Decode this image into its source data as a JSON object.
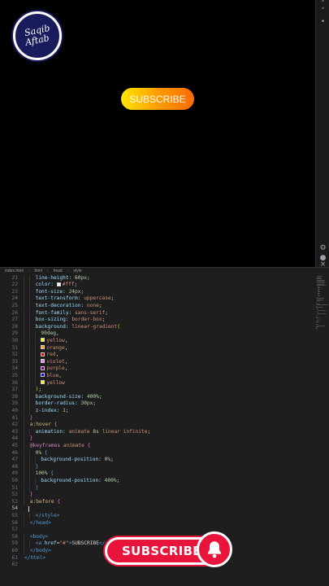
{
  "preview": {
    "logo_line1": "Saqib",
    "logo_line2": "Aftab",
    "button_label": "SUBSCRIBE"
  },
  "preview_bar": {
    "icons": [
      "chevron-up-icon",
      "chevron-down-icon",
      "dot-icon",
      "gear-icon",
      "account-icon",
      "close-icon"
    ]
  },
  "breadcrumb": [
    "index.html",
    "html",
    "head",
    "style"
  ],
  "code_lines": [
    {
      "n": "21",
      "indent": 2,
      "parts": [
        [
          "p",
          "line-height"
        ],
        [
          "w",
          ": "
        ],
        [
          "n",
          "60px"
        ],
        [
          "w",
          ";"
        ]
      ]
    },
    {
      "n": "22",
      "indent": 2,
      "parts": [
        [
          "p",
          "color"
        ],
        [
          "w",
          ": "
        ],
        [
          "sw",
          "#ffffff"
        ],
        [
          "v",
          "#fff"
        ],
        [
          "w",
          ";"
        ]
      ]
    },
    {
      "n": "23",
      "indent": 2,
      "parts": [
        [
          "p",
          "font-size"
        ],
        [
          "w",
          ": "
        ],
        [
          "n",
          "24px"
        ],
        [
          "w",
          ";"
        ]
      ]
    },
    {
      "n": "24",
      "indent": 2,
      "parts": [
        [
          "p",
          "text-transform"
        ],
        [
          "w",
          ": "
        ],
        [
          "v",
          "uppercase"
        ],
        [
          "w",
          ";"
        ]
      ]
    },
    {
      "n": "25",
      "indent": 2,
      "parts": [
        [
          "p",
          "text-decoration"
        ],
        [
          "w",
          ": "
        ],
        [
          "v",
          "none"
        ],
        [
          "w",
          ";"
        ]
      ]
    },
    {
      "n": "26",
      "indent": 2,
      "parts": [
        [
          "p",
          "font-family"
        ],
        [
          "w",
          ": "
        ],
        [
          "v",
          "sans-serif"
        ],
        [
          "w",
          ";"
        ]
      ]
    },
    {
      "n": "27",
      "indent": 2,
      "parts": [
        [
          "p",
          "box-sizing"
        ],
        [
          "w",
          ": "
        ],
        [
          "v",
          "border-box"
        ],
        [
          "w",
          ";"
        ]
      ]
    },
    {
      "n": "28",
      "indent": 2,
      "parts": [
        [
          "p",
          "background"
        ],
        [
          "w",
          ": "
        ],
        [
          "v",
          "linear-gradient"
        ],
        [
          "b1",
          "("
        ]
      ]
    },
    {
      "n": "29",
      "indent": 3,
      "parts": [
        [
          "n",
          "90deg"
        ],
        [
          "w",
          ","
        ]
      ]
    },
    {
      "n": "30",
      "indent": 3,
      "parts": [
        [
          "sw",
          "#ffff00"
        ],
        [
          "v",
          "yellow"
        ],
        [
          "w",
          ","
        ]
      ]
    },
    {
      "n": "31",
      "indent": 3,
      "parts": [
        [
          "sw",
          "#ffa500"
        ],
        [
          "v",
          "orange"
        ],
        [
          "w",
          ","
        ]
      ]
    },
    {
      "n": "32",
      "indent": 3,
      "parts": [
        [
          "sw",
          "#ff0000"
        ],
        [
          "v",
          "red"
        ],
        [
          "w",
          ","
        ]
      ]
    },
    {
      "n": "33",
      "indent": 3,
      "parts": [
        [
          "sw",
          "#ee82ee"
        ],
        [
          "v",
          "violet"
        ],
        [
          "w",
          ","
        ]
      ]
    },
    {
      "n": "34",
      "indent": 3,
      "parts": [
        [
          "sw",
          "#800080"
        ],
        [
          "v",
          "purple"
        ],
        [
          "w",
          ","
        ]
      ]
    },
    {
      "n": "35",
      "indent": 3,
      "parts": [
        [
          "sw",
          "#0000ff"
        ],
        [
          "v",
          "blue"
        ],
        [
          "w",
          ","
        ]
      ]
    },
    {
      "n": "36",
      "indent": 3,
      "parts": [
        [
          "sw",
          "#ffff00"
        ],
        [
          "v",
          "yellow"
        ]
      ]
    },
    {
      "n": "37",
      "indent": 2,
      "parts": [
        [
          "b1",
          ")"
        ],
        [
          "w",
          ";"
        ]
      ]
    },
    {
      "n": "38",
      "indent": 2,
      "parts": [
        [
          "p",
          "background-size"
        ],
        [
          "w",
          ": "
        ],
        [
          "n",
          "400%"
        ],
        [
          "w",
          ";"
        ]
      ]
    },
    {
      "n": "39",
      "indent": 2,
      "parts": [
        [
          "p",
          "border-radius"
        ],
        [
          "w",
          ": "
        ],
        [
          "n",
          "30px"
        ],
        [
          "w",
          ";"
        ]
      ]
    },
    {
      "n": "40",
      "indent": 2,
      "parts": [
        [
          "p",
          "z-index"
        ],
        [
          "w",
          ": "
        ],
        [
          "n",
          "1"
        ],
        [
          "w",
          ";"
        ]
      ]
    },
    {
      "n": "41",
      "indent": 1,
      "parts": [
        [
          "b2",
          "}"
        ]
      ]
    },
    {
      "n": "42",
      "indent": 1,
      "parts": [
        [
          "s",
          "a:hover"
        ],
        [
          "w",
          " "
        ],
        [
          "b2",
          "{"
        ]
      ]
    },
    {
      "n": "43",
      "indent": 2,
      "parts": [
        [
          "p",
          "animation"
        ],
        [
          "w",
          ": "
        ],
        [
          "v",
          "animate "
        ],
        [
          "n",
          "8s"
        ],
        [
          "v",
          " linear infinite"
        ],
        [
          "w",
          ";"
        ]
      ]
    },
    {
      "n": "44",
      "indent": 1,
      "parts": [
        [
          "b2",
          "}"
        ]
      ]
    },
    {
      "n": "45",
      "indent": 1,
      "parts": [
        [
          "k",
          "@keyframes"
        ],
        [
          "w",
          " "
        ],
        [
          "v",
          "animate"
        ],
        [
          "w",
          " "
        ],
        [
          "b2",
          "{"
        ]
      ]
    },
    {
      "n": "46",
      "indent": 2,
      "parts": [
        [
          "n",
          "0%"
        ],
        [
          "w",
          " "
        ],
        [
          "t",
          "{"
        ]
      ]
    },
    {
      "n": "47",
      "indent": 3,
      "parts": [
        [
          "p",
          "background-position"
        ],
        [
          "w",
          ": "
        ],
        [
          "n",
          "0%"
        ],
        [
          "w",
          ";"
        ]
      ]
    },
    {
      "n": "48",
      "indent": 2,
      "parts": [
        [
          "t",
          "}"
        ]
      ]
    },
    {
      "n": "49",
      "indent": 2,
      "parts": [
        [
          "n",
          "100%"
        ],
        [
          "w",
          " "
        ],
        [
          "t",
          "{"
        ]
      ]
    },
    {
      "n": "50",
      "indent": 3,
      "parts": [
        [
          "p",
          "background-position"
        ],
        [
          "w",
          ": "
        ],
        [
          "n",
          "400%"
        ],
        [
          "w",
          ";"
        ]
      ]
    },
    {
      "n": "51",
      "indent": 2,
      "parts": [
        [
          "t",
          "}"
        ]
      ]
    },
    {
      "n": "52",
      "indent": 1,
      "parts": [
        [
          "b2",
          "}"
        ]
      ]
    },
    {
      "n": "53",
      "indent": 1,
      "parts": [
        [
          "s",
          "a:before"
        ],
        [
          "w",
          " "
        ],
        [
          "b2",
          "{"
        ]
      ]
    },
    {
      "n": "54",
      "indent": 0,
      "parts": [],
      "cursor": true
    },
    {
      "n": "55",
      "indent": 2,
      "parts": [
        [
          "t",
          "</style>"
        ]
      ]
    },
    {
      "n": "56",
      "indent": 1,
      "parts": [
        [
          "t",
          "</head>"
        ]
      ]
    },
    {
      "n": "57",
      "indent": 0,
      "parts": []
    },
    {
      "n": "58",
      "indent": 1,
      "parts": [
        [
          "t",
          "<body>"
        ]
      ]
    },
    {
      "n": "59",
      "indent": 2,
      "parts": [
        [
          "t",
          "<a "
        ],
        [
          "p",
          "href"
        ],
        [
          "w",
          "="
        ],
        [
          "v",
          "\"#\""
        ],
        [
          "t",
          ">"
        ],
        [
          "w",
          "SUBSCRIBE"
        ],
        [
          "t",
          "</a>"
        ]
      ]
    },
    {
      "n": "60",
      "indent": 1,
      "parts": [
        [
          "t",
          "</body>"
        ]
      ]
    },
    {
      "n": "61",
      "indent": 0,
      "parts": [
        [
          "t",
          "</html>"
        ]
      ]
    },
    {
      "n": "62",
      "indent": 0,
      "parts": []
    }
  ],
  "sticker": {
    "label": "SUBSCRIBE",
    "icon": "bell-icon",
    "color": "#e8143c"
  }
}
